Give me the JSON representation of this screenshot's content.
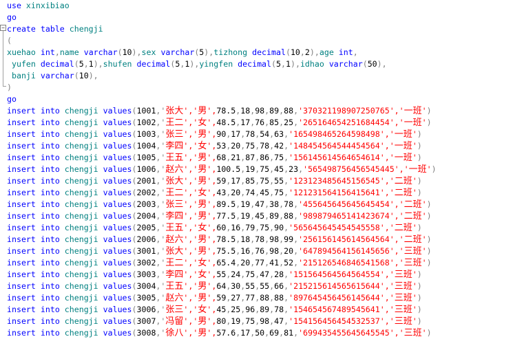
{
  "editor": {
    "header_lines": [
      [
        {
          "t": "use ",
          "c": "kw"
        },
        {
          "t": "xinxibiao",
          "c": "id"
        }
      ],
      [
        {
          "t": "go",
          "c": "kw"
        }
      ],
      [
        {
          "t": "create ",
          "c": "kw"
        },
        {
          "t": "table ",
          "c": "kw"
        },
        {
          "t": "chengji",
          "c": "id"
        }
      ],
      [
        {
          "t": "(",
          "c": "pun"
        }
      ],
      [
        {
          "t": "xuehao ",
          "c": "id"
        },
        {
          "t": "int",
          "c": "kw"
        },
        {
          "t": ",",
          "c": "pun"
        },
        {
          "t": "name ",
          "c": "id"
        },
        {
          "t": "varchar",
          "c": "kw"
        },
        {
          "t": "(",
          "c": "pun"
        },
        {
          "t": "10",
          "c": "num"
        },
        {
          "t": "),",
          "c": "pun"
        },
        {
          "t": "sex ",
          "c": "id"
        },
        {
          "t": "varchar",
          "c": "kw"
        },
        {
          "t": "(",
          "c": "pun"
        },
        {
          "t": "5",
          "c": "num"
        },
        {
          "t": "),",
          "c": "pun"
        },
        {
          "t": "tizhong ",
          "c": "id"
        },
        {
          "t": "decimal",
          "c": "kw"
        },
        {
          "t": "(",
          "c": "pun"
        },
        {
          "t": "10",
          "c": "num"
        },
        {
          "t": ",",
          "c": "pun"
        },
        {
          "t": "2",
          "c": "num"
        },
        {
          "t": "),",
          "c": "pun"
        },
        {
          "t": "age ",
          "c": "id"
        },
        {
          "t": "int",
          "c": "kw"
        },
        {
          "t": ",",
          "c": "pun"
        }
      ],
      [
        {
          "t": " yufen ",
          "c": "id"
        },
        {
          "t": "decimal",
          "c": "kw"
        },
        {
          "t": "(",
          "c": "pun"
        },
        {
          "t": "5",
          "c": "num"
        },
        {
          "t": ",",
          "c": "pun"
        },
        {
          "t": "1",
          "c": "num"
        },
        {
          "t": "),",
          "c": "pun"
        },
        {
          "t": "shufen ",
          "c": "id"
        },
        {
          "t": "decimal",
          "c": "kw"
        },
        {
          "t": "(",
          "c": "pun"
        },
        {
          "t": "5",
          "c": "num"
        },
        {
          "t": ",",
          "c": "pun"
        },
        {
          "t": "1",
          "c": "num"
        },
        {
          "t": "),",
          "c": "pun"
        },
        {
          "t": "yingfen ",
          "c": "id"
        },
        {
          "t": "decimal",
          "c": "kw"
        },
        {
          "t": "(",
          "c": "pun"
        },
        {
          "t": "5",
          "c": "num"
        },
        {
          "t": ",",
          "c": "pun"
        },
        {
          "t": "1",
          "c": "num"
        },
        {
          "t": "),",
          "c": "pun"
        },
        {
          "t": "idhao ",
          "c": "id"
        },
        {
          "t": "varchar",
          "c": "kw"
        },
        {
          "t": "(",
          "c": "pun"
        },
        {
          "t": "50",
          "c": "num"
        },
        {
          "t": "),",
          "c": "pun"
        }
      ],
      [
        {
          "t": " banji ",
          "c": "id"
        },
        {
          "t": "varchar",
          "c": "kw"
        },
        {
          "t": "(",
          "c": "pun"
        },
        {
          "t": "10",
          "c": "num"
        },
        {
          "t": "),",
          "c": "pun"
        }
      ],
      [
        {
          "t": ")",
          "c": "pun"
        }
      ],
      [
        {
          "t": "go",
          "c": "kw"
        }
      ]
    ],
    "insert_prefix": {
      "kw1": "insert ",
      "kw2": "into ",
      "table": "chengji ",
      "kw3": "values"
    },
    "rows": [
      [
        "1001",
        "张大",
        "男",
        "78.5",
        "18",
        "98",
        "89",
        "88",
        "370321198907250765",
        "一班"
      ],
      [
        "1002",
        "王二",
        "女",
        "48.5",
        "17",
        "76",
        "85",
        "25",
        "265164654251684454",
        "一班"
      ],
      [
        "1003",
        "张三",
        "男",
        "90",
        "17",
        "78",
        "54",
        "63",
        "165498465264598498",
        "一班"
      ],
      [
        "1004",
        "李四",
        "女",
        "53",
        "20",
        "75",
        "78",
        "42",
        "148454564544454564",
        "一班"
      ],
      [
        "1005",
        "王五",
        "男",
        "68",
        "21",
        "87",
        "86",
        "75",
        "156145614564654614",
        "一班"
      ],
      [
        "1006",
        "赵六",
        "男",
        "100.5",
        "19",
        "75",
        "45",
        "23",
        "565498756456545445",
        "一班"
      ],
      [
        "2001",
        "张大",
        "男",
        "59",
        "17",
        "85",
        "75",
        "55",
        "123123485645156545",
        "二班"
      ],
      [
        "2002",
        "王二",
        "女",
        "43",
        "20",
        "74",
        "45",
        "75",
        "121231564156415641",
        "二班"
      ],
      [
        "2003",
        "张三",
        "男",
        "89.5",
        "19",
        "47",
        "38",
        "78",
        "455645645645645454",
        "二班"
      ],
      [
        "2004",
        "李四",
        "男",
        "77.5",
        "19",
        "45",
        "89",
        "88",
        "989879465141423674",
        "二班"
      ],
      [
        "2005",
        "王五",
        "女",
        "60",
        "16",
        "79",
        "75",
        "90",
        "565645645454545558",
        "二班"
      ],
      [
        "2006",
        "赵六",
        "男",
        "78.5",
        "18",
        "78",
        "98",
        "99",
        "256156145614564564",
        "二班"
      ],
      [
        "3001",
        "张大",
        "男",
        "75.5",
        "16",
        "76",
        "98",
        "20",
        "647894564156145656",
        "三班"
      ],
      [
        "3002",
        "王二",
        "女",
        "65.4",
        "20",
        "77",
        "41",
        "52",
        "215126546846541568",
        "三班"
      ],
      [
        "3003",
        "李四",
        "女",
        "55",
        "24",
        "75",
        "47",
        "28",
        "151564564564564554",
        "三班"
      ],
      [
        "3004",
        "王五",
        "男",
        "64",
        "30",
        "55",
        "55",
        "66",
        "215215614565615644",
        "三班"
      ],
      [
        "3005",
        "赵六",
        "男",
        "59",
        "27",
        "77",
        "88",
        "88",
        "897645456456145644",
        "三班"
      ],
      [
        "3006",
        "张三",
        "女",
        "45",
        "25",
        "96",
        "89",
        "78",
        "154654567489545641",
        "三班"
      ],
      [
        "3007",
        "冯留",
        "男",
        "80",
        "19",
        "75",
        "98",
        "47",
        "154156456454532537",
        "三班"
      ],
      [
        "3008",
        "徐八",
        "男",
        "57.6",
        "17",
        "50",
        "69",
        "81",
        "699435455645645545",
        "三班"
      ]
    ],
    "colors": {
      "keyword": "#0000ff",
      "identifier": "#008080",
      "string": "#ff0000",
      "punctuation": "#808080",
      "number": "#000000"
    }
  }
}
